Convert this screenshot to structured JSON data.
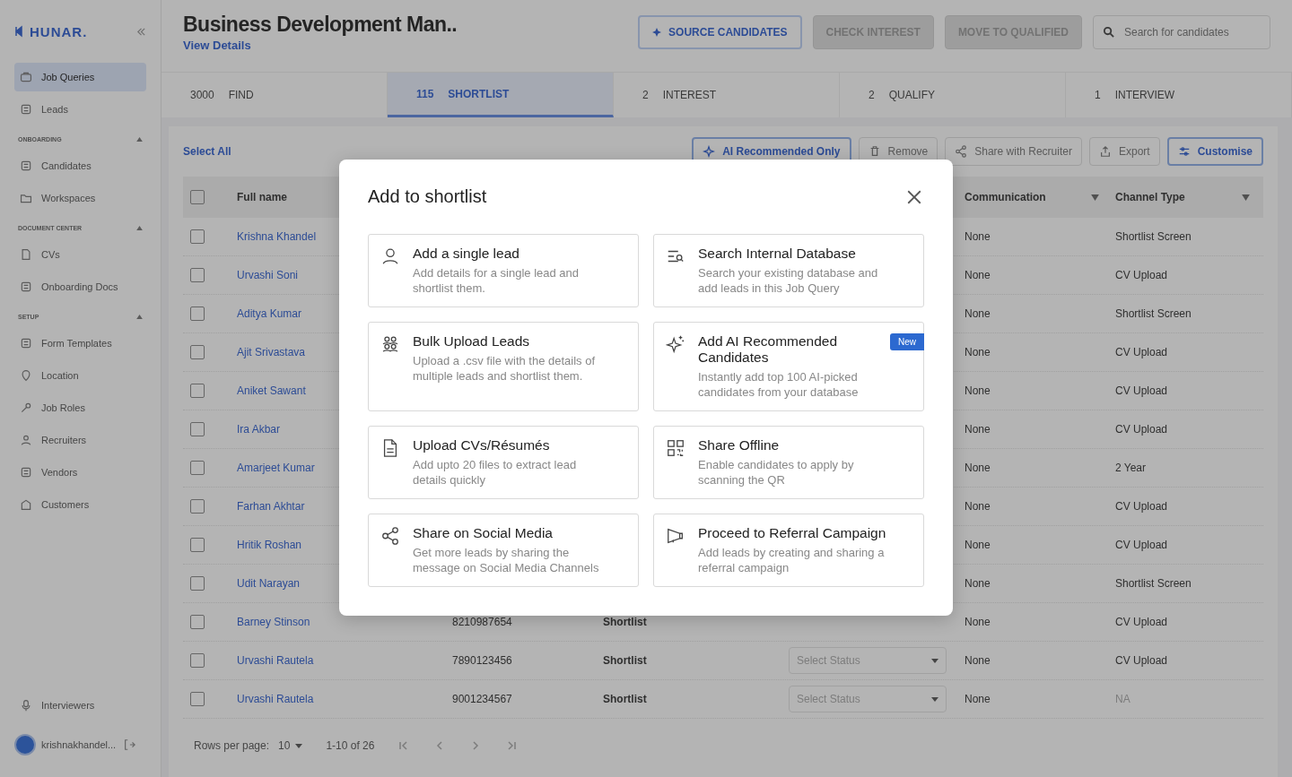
{
  "sidebar": {
    "logo": "HUNAR.",
    "groups": [
      {
        "items": [
          {
            "label": "Job Queries",
            "selected": true
          },
          {
            "label": "Leads",
            "selected": false
          }
        ]
      },
      {
        "heading": "ONBOARDING",
        "items": [
          {
            "label": "Candidates",
            "selected": false
          },
          {
            "label": "Workspaces",
            "selected": false
          }
        ]
      },
      {
        "heading": "DOCUMENT CENTER",
        "items": [
          {
            "label": "CVs",
            "selected": false
          },
          {
            "label": "Onboarding Docs",
            "selected": false
          }
        ]
      },
      {
        "heading": "SETUP",
        "items": [
          {
            "label": "Form Templates",
            "selected": false
          },
          {
            "label": "Location",
            "selected": false
          },
          {
            "label": "Job Roles",
            "selected": false
          },
          {
            "label": "Recruiters",
            "selected": false
          },
          {
            "label": "Vendors",
            "selected": false
          },
          {
            "label": "Customers",
            "selected": false
          }
        ]
      }
    ],
    "bottom_item": {
      "label": "Interviewers"
    },
    "user": "krishnakhandel..."
  },
  "header": {
    "title": "Business Development Man..",
    "link": "View Details",
    "buttons": [
      {
        "label": "SOURCE CANDIDATES",
        "disabled": false
      },
      {
        "label": "CHECK INTEREST",
        "disabled": true
      },
      {
        "label": "MOVE TO QUALIFIED",
        "disabled": true
      }
    ],
    "search": {
      "placeholder": "Search for candidates"
    }
  },
  "tabs": [
    {
      "count": "3000",
      "label": "FIND",
      "selected": false
    },
    {
      "count": "115",
      "label": "SHORTLIST",
      "selected": true
    },
    {
      "count": "2",
      "label": "INTEREST",
      "selected": false
    },
    {
      "count": "2",
      "label": "QUALIFY",
      "selected": false
    },
    {
      "count": "1",
      "label": "INTERVIEW",
      "selected": false
    }
  ],
  "toolbar": {
    "select_all": "Select All",
    "buttons": [
      {
        "label": "AI Recommended Only",
        "highlighted": true
      },
      {
        "label": "Remove",
        "highlighted": false
      },
      {
        "label": "Share with Recruiter",
        "highlighted": false
      },
      {
        "label": "Export",
        "highlighted": false
      },
      {
        "label": "Customise",
        "highlighted": true
      }
    ]
  },
  "table": {
    "all_checked": false,
    "columns": [
      "Full name",
      "Communication",
      "Channel Type"
    ],
    "rows": [
      {
        "checked": false,
        "name": "Krishna Khandel",
        "communication": "None",
        "channel": "Shortlist Screen"
      },
      {
        "checked": false,
        "name": "Urvashi Soni",
        "communication": "None",
        "channel": "CV Upload"
      },
      {
        "checked": false,
        "name": "Aditya Kumar",
        "communication": "None",
        "channel": "Shortlist Screen"
      },
      {
        "checked": false,
        "name": "Ajit Srivastava",
        "communication": "None",
        "channel": "CV Upload"
      },
      {
        "checked": false,
        "name": "Aniket Sawant",
        "communication": "None",
        "channel": "CV Upload"
      },
      {
        "checked": false,
        "name": "Ira Akbar",
        "communication": "None",
        "channel": "CV Upload"
      },
      {
        "checked": false,
        "name": "Amarjeet Kumar",
        "communication": "None",
        "channel": "2 Year"
      },
      {
        "checked": false,
        "name": "Farhan Akhtar",
        "communication": "None",
        "channel": "CV Upload"
      },
      {
        "checked": false,
        "name": "Hritik Roshan",
        "communication": "None",
        "channel": "CV Upload"
      },
      {
        "checked": false,
        "name": "Udit Narayan",
        "communication": "None",
        "channel": "Shortlist Screen"
      },
      {
        "checked": false,
        "name": "Barney Stinson",
        "phone": "8210987654",
        "stage": "Shortlist",
        "communication": "None",
        "channel": "CV Upload"
      },
      {
        "checked": false,
        "name": "Urvashi Rautela",
        "phone": "7890123456",
        "stage": "Shortlist",
        "status_placeholder": "Select Status",
        "communication": "None",
        "channel": "CV Upload"
      },
      {
        "checked": false,
        "name": "Urvashi Rautela",
        "phone": "9001234567",
        "stage": "Shortlist",
        "status_placeholder": "Select Status",
        "communication": "None",
        "channel": "NA",
        "channel_empty": true
      }
    ]
  },
  "pagination": {
    "rows_label": "Rows per page:",
    "rows_value": "10",
    "range": "1-10 of 26"
  },
  "modal": {
    "title": "Add to shortlist",
    "options": [
      {
        "title": "Add a single lead",
        "description": "Add details for a single lead and shortlist them."
      },
      {
        "title": "Search Internal Database",
        "description": "Search your existing database and add leads in this Job Query"
      },
      {
        "title": "Bulk Upload Leads",
        "description": "Upload a .csv file with the details of multiple leads and shortlist them."
      },
      {
        "title": "Add AI Recommended Candidates",
        "description": "Instantly add top 100 AI-picked candidates from your database",
        "badge": "New"
      },
      {
        "title": "Upload CVs/Résumés",
        "description": "Add upto 20 files to extract lead details quickly"
      },
      {
        "title": "Share Offline",
        "description": "Enable candidates to apply by scanning the QR"
      },
      {
        "title": "Share on Social Media",
        "description": "Get more leads by sharing the message on Social Media Channels"
      },
      {
        "title": "Proceed to Referral Campaign",
        "description": "Add leads by creating and sharing a referral campaign"
      }
    ]
  }
}
